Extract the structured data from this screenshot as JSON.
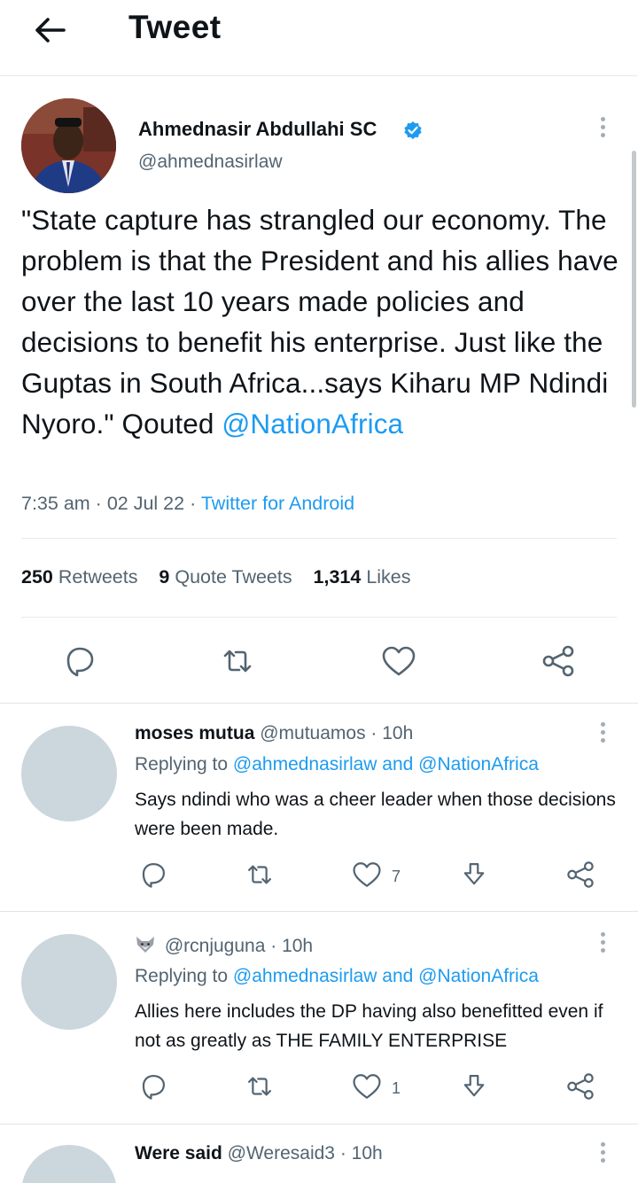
{
  "header": {
    "title": "Tweet"
  },
  "tweet": {
    "author_name": "Ahmednasir Abdullahi SC",
    "author_handle": "@ahmednasirlaw",
    "text_main": "\"State capture has strangled our economy. The problem is that the President and his allies have over the last 10 years made policies and decisions to benefit his enterprise. Just like the Guptas in South Africa...says Kiharu MP Ndindi Nyoro.\" Qouted",
    "text_mention": "@NationAfrica",
    "time": "7:35 am",
    "date": "02 Jul 22",
    "source": "Twitter for Android",
    "dot": "·",
    "retweets_count": "250",
    "retweets_label": "Retweets",
    "quotes_count": "9",
    "quotes_label": "Quote Tweets",
    "likes_count": "1,314",
    "likes_label": "Likes"
  },
  "replies": [
    {
      "name": "moses mutua",
      "handle": "@mutuamos",
      "time": "· 10h",
      "replying_prefix": "Replying to",
      "replying_to": "@ahmednasirlaw and @NationAfrica",
      "text": "Says ndindi who was a cheer leader when those decisions were been made.",
      "like_count": "7"
    },
    {
      "name": "",
      "handle": "@rcnjuguna",
      "time": "· 10h",
      "replying_prefix": "Replying to",
      "replying_to": "@ahmednasirlaw and @NationAfrica",
      "text": "Allies here includes the DP having also benefitted even if not as greatly as THE FAMILY ENTERPRISE",
      "like_count": "1"
    },
    {
      "name": "Were said",
      "handle": "@Weresaid3",
      "time": "· 10h"
    }
  ],
  "icons": {
    "back": "arrow-left-icon",
    "verified": "verified-badge-icon",
    "reply": "reply-icon",
    "retweet": "retweet-icon",
    "like": "heart-icon",
    "share": "share-icon",
    "download": "download-icon",
    "more": "more-vertical-icon"
  },
  "colors": {
    "accent": "#1d9bf0",
    "text": "#0f1419",
    "secondary": "#536471",
    "avatar_placeholder": "#ccd6dd"
  }
}
